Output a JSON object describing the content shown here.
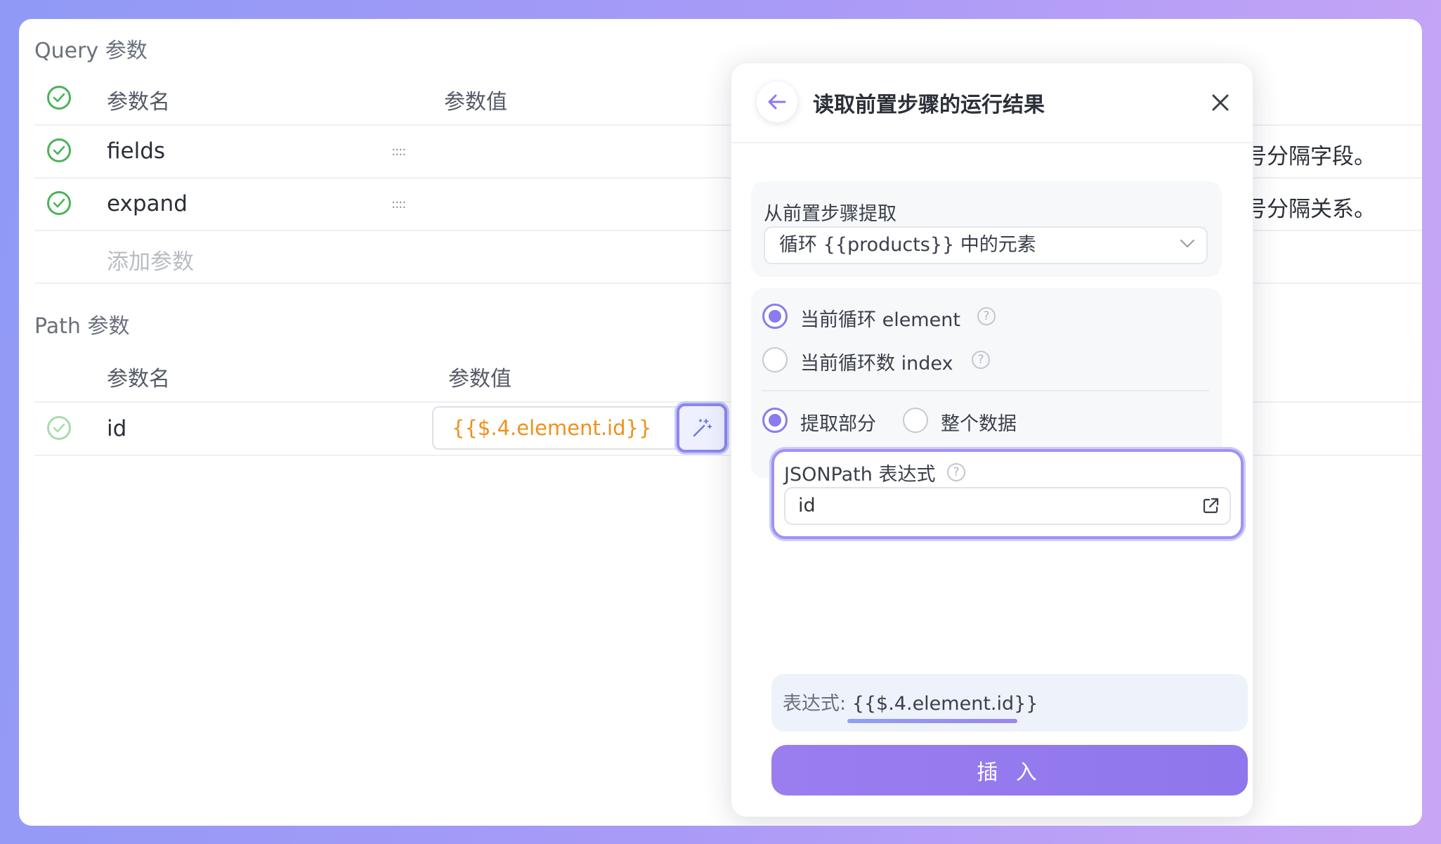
{
  "query_section": {
    "title": "Query 参数",
    "header": {
      "name": "参数名",
      "value": "参数值"
    },
    "rows": [
      {
        "name": "fields",
        "desc_tail": "号分隔字段。"
      },
      {
        "name": "expand",
        "desc_tail": "号分隔关系。"
      }
    ],
    "add_placeholder": "添加参数"
  },
  "path_section": {
    "title": "Path 参数",
    "header": {
      "name": "参数名",
      "value": "参数值"
    },
    "rows": [
      {
        "name": "id",
        "value": "{{$.4.element.id}}"
      }
    ]
  },
  "popover": {
    "title": "读取前置步骤的运行结果",
    "source_label": "从前置步骤提取",
    "source_selected": "循环 {{products}} 中的元素",
    "loop_options": [
      {
        "label": "当前循环 element",
        "selected": true
      },
      {
        "label": "当前循环数 index",
        "selected": false
      }
    ],
    "extract_options": [
      {
        "label": "提取部分",
        "selected": true
      },
      {
        "label": "整个数据",
        "selected": false
      }
    ],
    "jsonpath_label": "JSONPath 表达式",
    "jsonpath_value": "id",
    "expression_prefix": "表达式: ",
    "expression_value": "{{$.4.element.id}}",
    "insert_label": "插 入"
  },
  "colors": {
    "accent": "#8f76ec",
    "check_green": "#4cb25a",
    "value_orange": "#f0901a"
  }
}
